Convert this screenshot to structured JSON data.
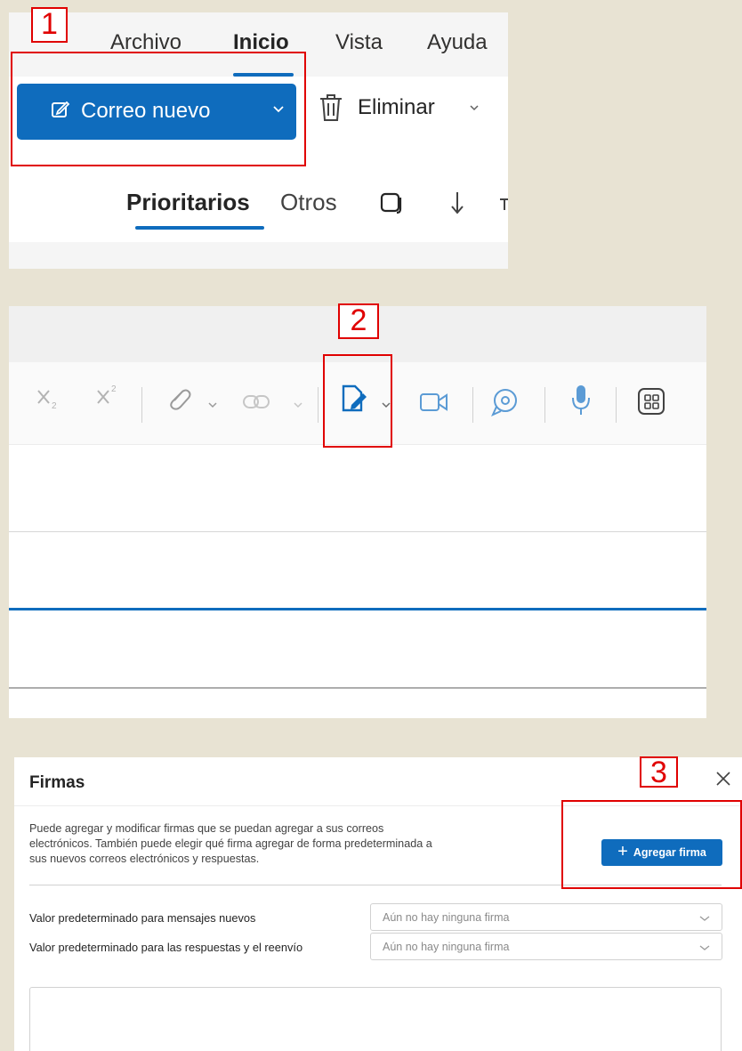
{
  "steps": [
    "1",
    "2",
    "3"
  ],
  "panel1": {
    "menu": [
      "Archivo",
      "Inicio",
      "Vista",
      "Ayuda"
    ],
    "new_mail_label": "Correo nuevo",
    "delete_label": "Eliminar",
    "tab_focused": "Prioritarios",
    "tab_other": "Otros"
  },
  "panel2": {
    "toolbar_icons": [
      "subscript-icon",
      "superscript-icon",
      "attach-icon",
      "link-icon",
      "signature-icon",
      "video-meeting-icon",
      "loop-icon",
      "dictate-icon",
      "apps-icon"
    ]
  },
  "panel3": {
    "title": "Firmas",
    "description": "Puede agregar y modificar firmas que se puedan agregar a sus correos electrónicos. También puede elegir qué firma agregar de forma predeterminada a sus nuevos correos electrónicos y respuestas.",
    "add_button": "Agregar firma",
    "new_messages_label": "Valor predeterminado para mensajes nuevos",
    "new_messages_value": "Aún no hay ninguna firma",
    "replies_label": "Valor predeterminado para las respuestas y el reenvío",
    "replies_value": "Aún no hay ninguna firma"
  },
  "colors": {
    "accent": "#0f6cbd",
    "highlight": "#e00000",
    "backdrop": "#e8e3d3"
  }
}
